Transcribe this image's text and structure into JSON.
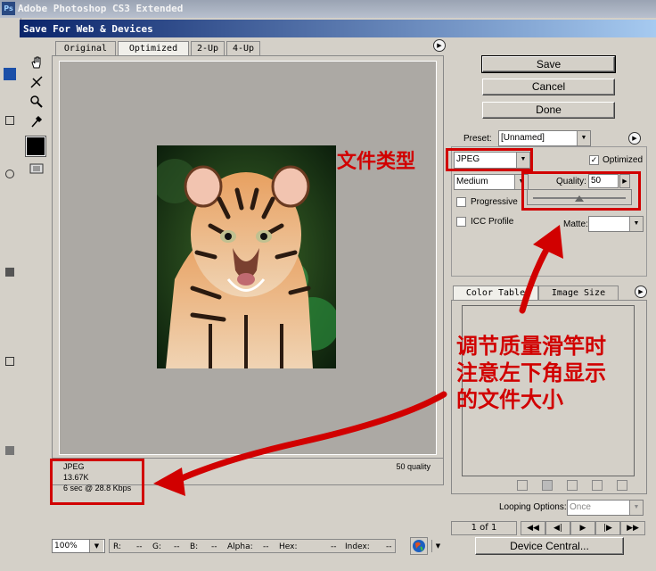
{
  "app_title": "Adobe Photoshop CS3 Extended",
  "app_icon": "Ps",
  "dialog_title": "Save For Web & Devices",
  "tabs": [
    "Original",
    "Optimized",
    "2-Up",
    "4-Up"
  ],
  "active_tab": "Optimized",
  "buttons": {
    "save": "Save",
    "cancel": "Cancel",
    "done": "Done",
    "device_central": "Device Central..."
  },
  "preset": {
    "label": "Preset:",
    "value": "[Unnamed]"
  },
  "format": {
    "value": "JPEG"
  },
  "optimized": {
    "label": "Optimized",
    "checked": true
  },
  "compression": {
    "value": "Medium"
  },
  "quality": {
    "label": "Quality:",
    "value": "50",
    "slider_fraction": 0.5
  },
  "progressive": {
    "label": "Progressive",
    "checked": false
  },
  "icc_profile": {
    "label": "ICC Profile",
    "checked": false
  },
  "matte": {
    "label": "Matte:",
    "value": ""
  },
  "panel_tabs": [
    "Color Table",
    "Image Size"
  ],
  "image_info": {
    "format": "JPEG",
    "size": "13.67K",
    "time": "6 sec @ 28.8 Kbps",
    "quality": "50 quality"
  },
  "status": {
    "zoom": "100%",
    "r_label": "R:",
    "r_value": "--",
    "g_label": "G:",
    "g_value": "--",
    "b_label": "B:",
    "b_value": "--",
    "alpha_label": "Alpha:",
    "alpha_value": "--",
    "hex_label": "Hex:",
    "hex_value": "--",
    "index_label": "Index:",
    "index_value": "--"
  },
  "looping": {
    "label": "Looping Options:",
    "value": "Once"
  },
  "frame_counter": "1 of 1",
  "annotations": {
    "file_type": "文件类型",
    "note_line1": "调节质量滑竿时",
    "note_line2": "注意左下角显示",
    "note_line3": "的文件大小"
  },
  "colors": {
    "annotation_red": "#d10000",
    "title_bar_start": "#0a246a",
    "title_bar_end": "#a6caf0",
    "dialog_bg": "#d4d0c8"
  }
}
